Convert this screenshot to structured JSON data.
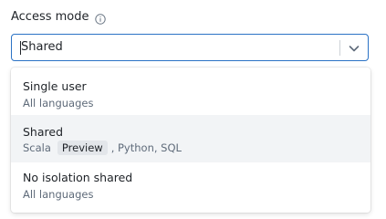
{
  "field": {
    "label": "Access mode",
    "info_icon": "info-icon"
  },
  "select": {
    "value": "Shared",
    "chevron_icon": "chevron-down-icon"
  },
  "options": [
    {
      "title": "Single user",
      "subtitle": "All languages"
    },
    {
      "title": "Shared",
      "subtitle_prefix": "Scala",
      "badge": "Preview",
      "subtitle_suffix": ", Python, SQL",
      "selected": true
    },
    {
      "title": "No isolation shared",
      "subtitle": "All languages"
    }
  ],
  "colors": {
    "focus_border": "#2b72c5",
    "selected_bg": "#f2f4f6"
  }
}
